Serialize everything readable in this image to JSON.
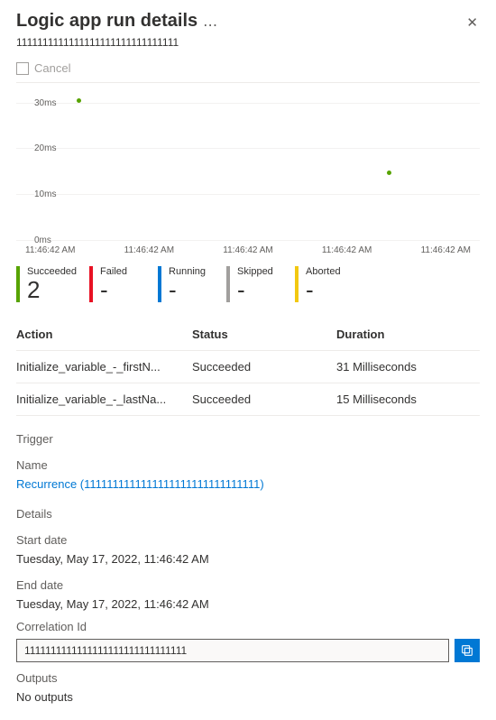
{
  "header": {
    "title": "Logic app run details",
    "subtitle": "1111111111111111111111111111111"
  },
  "toolbar": {
    "cancel_label": "Cancel"
  },
  "chart_data": {
    "type": "scatter",
    "title": "",
    "xlabel": "",
    "ylabel": "",
    "ylim": [
      0,
      30
    ],
    "y_ticks": [
      "30ms",
      "20ms",
      "10ms",
      "0ms"
    ],
    "x_ticks": [
      "11:46:42 AM",
      "11:46:42 AM",
      "11:46:42 AM",
      "11:46:42 AM",
      "11:46:42 AM"
    ],
    "x": [
      "11:46:42 AM",
      "11:46:42 AM"
    ],
    "values": [
      31,
      15
    ],
    "series_color": "#57a300"
  },
  "counters": [
    {
      "label": "Succeeded",
      "value": "2",
      "color": "green"
    },
    {
      "label": "Failed",
      "value": "-",
      "color": "red"
    },
    {
      "label": "Running",
      "value": "-",
      "color": "blue"
    },
    {
      "label": "Skipped",
      "value": "-",
      "color": "gray"
    },
    {
      "label": "Aborted",
      "value": "-",
      "color": "yellow"
    }
  ],
  "table": {
    "headers": {
      "action": "Action",
      "status": "Status",
      "duration": "Duration"
    },
    "rows": [
      {
        "action": "Initialize_variable_-_firstN...",
        "status": "Succeeded",
        "duration": "31 Milliseconds"
      },
      {
        "action": "Initialize_variable_-_lastNa...",
        "status": "Succeeded",
        "duration": "15 Milliseconds"
      }
    ]
  },
  "trigger": {
    "section_label": "Trigger",
    "name_label": "Name",
    "name_link": "Recurrence (1111111111111111111111111111111)"
  },
  "details": {
    "section_label": "Details",
    "start_label": "Start date",
    "start_value": "Tuesday, May 17, 2022, 11:46:42 AM",
    "end_label": "End date",
    "end_value": "Tuesday, May 17, 2022, 11:46:42 AM",
    "corr_label": "Correlation Id",
    "corr_value": "1111111111111111111111111111111"
  },
  "outputs": {
    "label": "Outputs",
    "value": "No outputs"
  }
}
